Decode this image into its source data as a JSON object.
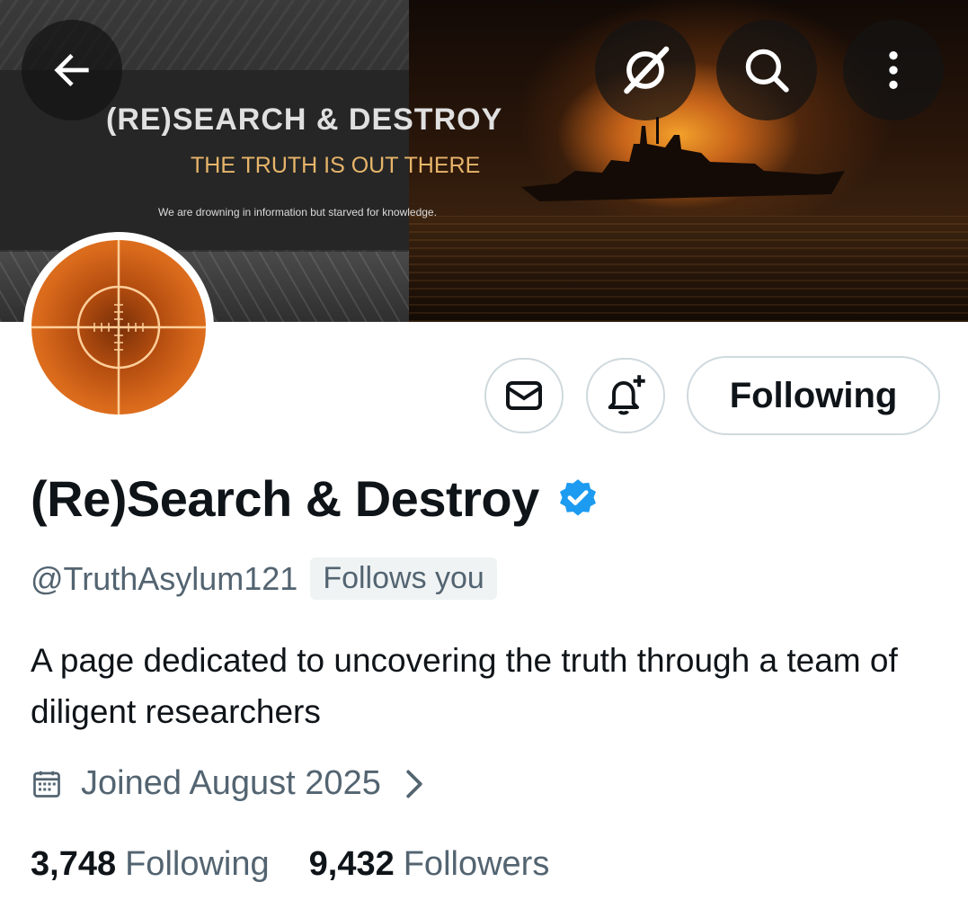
{
  "banner": {
    "title": "(RE)SEARCH & DESTROY",
    "subtitle": "THE TRUTH IS OUT THERE",
    "tagline": "We are drowning in information but starved for knowledge."
  },
  "toolbar": {
    "back_icon": "arrow-left-icon",
    "grok_icon": "grok-icon",
    "search_icon": "search-icon",
    "more_icon": "more-vertical-icon"
  },
  "actions": {
    "message_icon": "envelope-icon",
    "notify_icon": "bell-plus-icon",
    "follow_label": "Following"
  },
  "profile": {
    "display_name": "(Re)Search & Destroy",
    "verified": true,
    "handle": "@TruthAsylum121",
    "follows_you": "Follows you",
    "bio": "A page dedicated to uncovering the truth through a team of diligent researchers",
    "joined": "Joined August 2025"
  },
  "stats": {
    "following_count": "3,748",
    "following_label": "Following",
    "followers_count": "9,432",
    "followers_label": "Followers"
  },
  "colors": {
    "verified_blue": "#1d9bf0",
    "secondary_text": "#536471",
    "border": "#cfd9de"
  }
}
